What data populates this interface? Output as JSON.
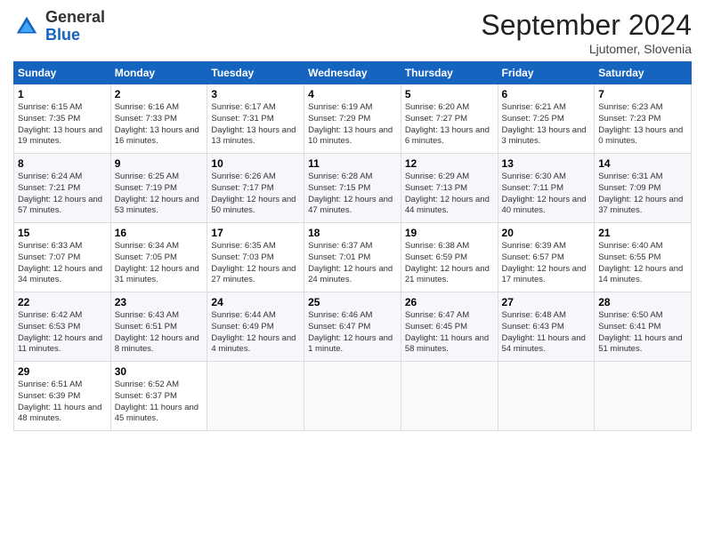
{
  "logo": {
    "general": "General",
    "blue": "Blue"
  },
  "title": "September 2024",
  "location": "Ljutomer, Slovenia",
  "days_header": [
    "Sunday",
    "Monday",
    "Tuesday",
    "Wednesday",
    "Thursday",
    "Friday",
    "Saturday"
  ],
  "weeks": [
    [
      {
        "day": "1",
        "sunrise": "6:15 AM",
        "sunset": "7:35 PM",
        "daylight": "13 hours and 19 minutes."
      },
      {
        "day": "2",
        "sunrise": "6:16 AM",
        "sunset": "7:33 PM",
        "daylight": "13 hours and 16 minutes."
      },
      {
        "day": "3",
        "sunrise": "6:17 AM",
        "sunset": "7:31 PM",
        "daylight": "13 hours and 13 minutes."
      },
      {
        "day": "4",
        "sunrise": "6:19 AM",
        "sunset": "7:29 PM",
        "daylight": "13 hours and 10 minutes."
      },
      {
        "day": "5",
        "sunrise": "6:20 AM",
        "sunset": "7:27 PM",
        "daylight": "13 hours and 6 minutes."
      },
      {
        "day": "6",
        "sunrise": "6:21 AM",
        "sunset": "7:25 PM",
        "daylight": "13 hours and 3 minutes."
      },
      {
        "day": "7",
        "sunrise": "6:23 AM",
        "sunset": "7:23 PM",
        "daylight": "13 hours and 0 minutes."
      }
    ],
    [
      {
        "day": "8",
        "sunrise": "6:24 AM",
        "sunset": "7:21 PM",
        "daylight": "12 hours and 57 minutes."
      },
      {
        "day": "9",
        "sunrise": "6:25 AM",
        "sunset": "7:19 PM",
        "daylight": "12 hours and 53 minutes."
      },
      {
        "day": "10",
        "sunrise": "6:26 AM",
        "sunset": "7:17 PM",
        "daylight": "12 hours and 50 minutes."
      },
      {
        "day": "11",
        "sunrise": "6:28 AM",
        "sunset": "7:15 PM",
        "daylight": "12 hours and 47 minutes."
      },
      {
        "day": "12",
        "sunrise": "6:29 AM",
        "sunset": "7:13 PM",
        "daylight": "12 hours and 44 minutes."
      },
      {
        "day": "13",
        "sunrise": "6:30 AM",
        "sunset": "7:11 PM",
        "daylight": "12 hours and 40 minutes."
      },
      {
        "day": "14",
        "sunrise": "6:31 AM",
        "sunset": "7:09 PM",
        "daylight": "12 hours and 37 minutes."
      }
    ],
    [
      {
        "day": "15",
        "sunrise": "6:33 AM",
        "sunset": "7:07 PM",
        "daylight": "12 hours and 34 minutes."
      },
      {
        "day": "16",
        "sunrise": "6:34 AM",
        "sunset": "7:05 PM",
        "daylight": "12 hours and 31 minutes."
      },
      {
        "day": "17",
        "sunrise": "6:35 AM",
        "sunset": "7:03 PM",
        "daylight": "12 hours and 27 minutes."
      },
      {
        "day": "18",
        "sunrise": "6:37 AM",
        "sunset": "7:01 PM",
        "daylight": "12 hours and 24 minutes."
      },
      {
        "day": "19",
        "sunrise": "6:38 AM",
        "sunset": "6:59 PM",
        "daylight": "12 hours and 21 minutes."
      },
      {
        "day": "20",
        "sunrise": "6:39 AM",
        "sunset": "6:57 PM",
        "daylight": "12 hours and 17 minutes."
      },
      {
        "day": "21",
        "sunrise": "6:40 AM",
        "sunset": "6:55 PM",
        "daylight": "12 hours and 14 minutes."
      }
    ],
    [
      {
        "day": "22",
        "sunrise": "6:42 AM",
        "sunset": "6:53 PM",
        "daylight": "12 hours and 11 minutes."
      },
      {
        "day": "23",
        "sunrise": "6:43 AM",
        "sunset": "6:51 PM",
        "daylight": "12 hours and 8 minutes."
      },
      {
        "day": "24",
        "sunrise": "6:44 AM",
        "sunset": "6:49 PM",
        "daylight": "12 hours and 4 minutes."
      },
      {
        "day": "25",
        "sunrise": "6:46 AM",
        "sunset": "6:47 PM",
        "daylight": "12 hours and 1 minute."
      },
      {
        "day": "26",
        "sunrise": "6:47 AM",
        "sunset": "6:45 PM",
        "daylight": "11 hours and 58 minutes."
      },
      {
        "day": "27",
        "sunrise": "6:48 AM",
        "sunset": "6:43 PM",
        "daylight": "11 hours and 54 minutes."
      },
      {
        "day": "28",
        "sunrise": "6:50 AM",
        "sunset": "6:41 PM",
        "daylight": "11 hours and 51 minutes."
      }
    ],
    [
      {
        "day": "29",
        "sunrise": "6:51 AM",
        "sunset": "6:39 PM",
        "daylight": "11 hours and 48 minutes."
      },
      {
        "day": "30",
        "sunrise": "6:52 AM",
        "sunset": "6:37 PM",
        "daylight": "11 hours and 45 minutes."
      },
      null,
      null,
      null,
      null,
      null
    ]
  ]
}
